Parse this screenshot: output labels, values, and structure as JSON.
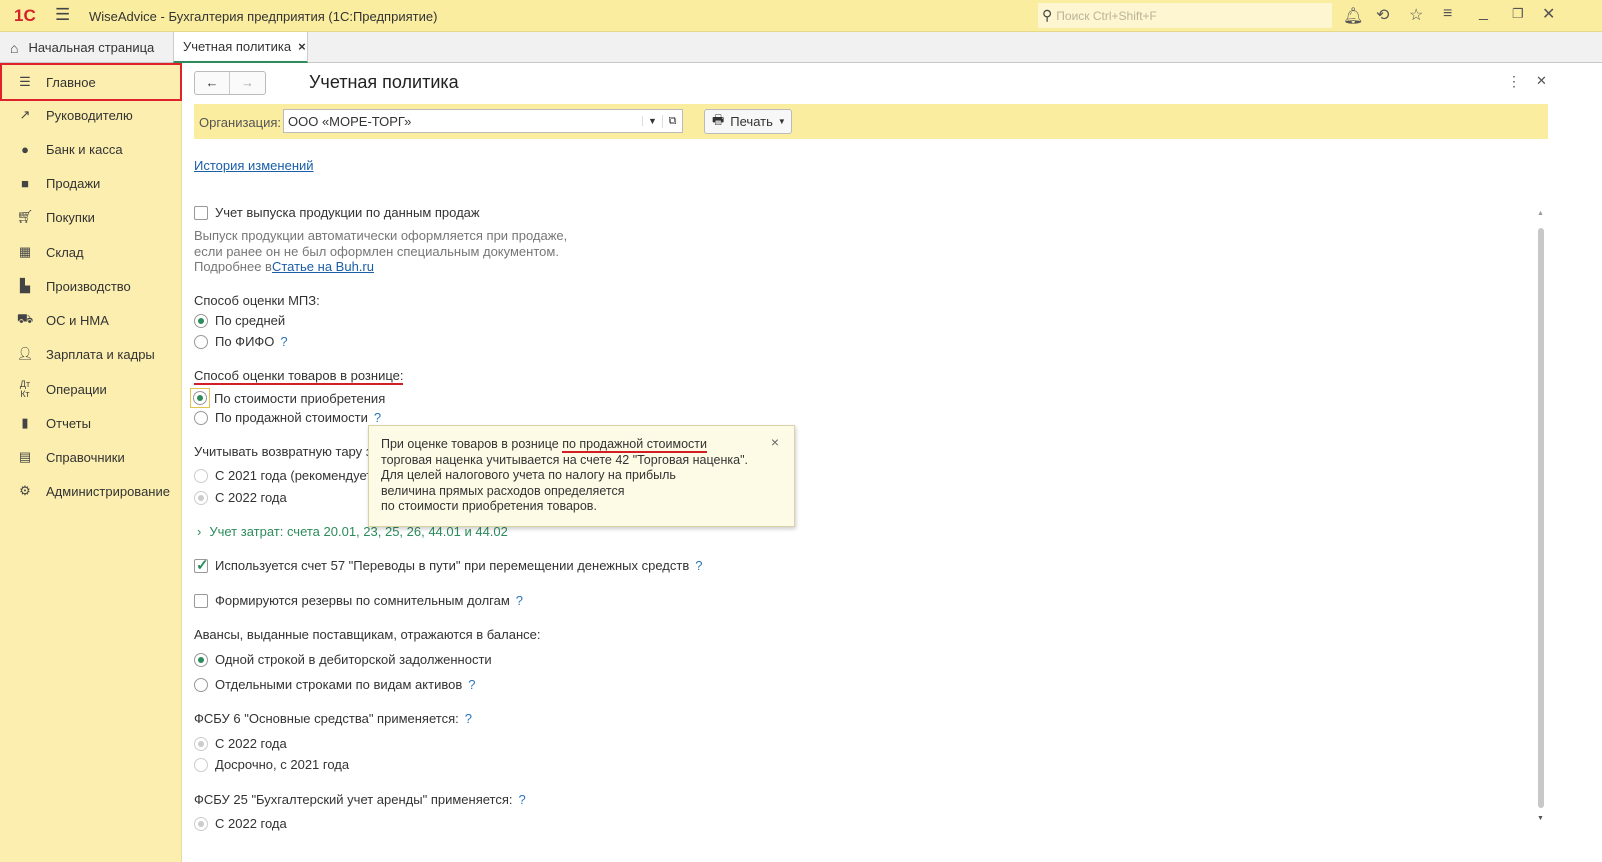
{
  "window": {
    "title": "WiseAdvice - Бухгалтерия предприятия  (1С:Предприятие)",
    "logo": "1С",
    "search_placeholder": "Поиск Ctrl+Shift+F"
  },
  "tabs": [
    {
      "label": "Начальная страница"
    },
    {
      "label": "Учетная политика",
      "close": "×"
    }
  ],
  "sidebar": {
    "items": [
      {
        "label": "Главное",
        "icon": "menu-icon"
      },
      {
        "label": "Руководителю",
        "icon": "trend-icon"
      },
      {
        "label": "Банк и касса",
        "icon": "coin-icon"
      },
      {
        "label": "Продажи",
        "icon": "bag-icon"
      },
      {
        "label": "Покупки",
        "icon": "cart-icon"
      },
      {
        "label": "Склад",
        "icon": "grid-icon"
      },
      {
        "label": "Производство",
        "icon": "factory-icon"
      },
      {
        "label": "ОС и НМА",
        "icon": "truck-icon"
      },
      {
        "label": "Зарплата и кадры",
        "icon": "person-icon"
      },
      {
        "label": "Операции",
        "icon": "operations-icon"
      },
      {
        "label": "Отчеты",
        "icon": "chart-icon"
      },
      {
        "label": "Справочники",
        "icon": "book-icon"
      },
      {
        "label": "Администрирование",
        "icon": "gear-icon"
      }
    ]
  },
  "form": {
    "title": "Учетная политика",
    "org_label": "Организация:",
    "org_value": "ООО «МОРЕ-ТОРГ»",
    "print_label": "Печать",
    "history_link": "История изменений",
    "release_cb": "Учет выпуска продукции по данным продаж",
    "release_hint1": "Выпуск продукции автоматически оформляется при продаже,",
    "release_hint2": "если ранее он не был оформлен специальным документом.",
    "release_hint3": "Подробнее в ",
    "release_link": "Статье на Buh.ru",
    "mpz_label": "Способ оценки МПЗ:",
    "mpz_opt1": "По средней",
    "mpz_opt2": "По ФИФО",
    "retail_label": "Способ оценки товаров в рознице:",
    "retail_opt1": "По стоимости приобретения",
    "retail_opt2": "По продажной стоимости",
    "tara_label": "Учитывать возвратную тару за",
    "tara_opt1": "С 2021 года (рекомендует",
    "tara_opt2": "С 2022 года",
    "costs_link": "Учет затрат: счета 20.01, 23, 25, 26, 44.01 и 44.02",
    "acc57_cb": "Используется счет 57 \"Переводы в пути\" при перемещении денежных средств",
    "reserve_cb": "Формируются резервы по сомнительным долгам",
    "adv_label": "Авансы, выданные поставщикам, отражаются в балансе:",
    "adv_opt1": "Одной строкой в дебиторской задолженности",
    "adv_opt2": "Отдельными строками по видам активов",
    "fsbu6_label": "ФСБУ 6 \"Основные средства\" применяется:",
    "fsbu6_opt1": "С 2022 года",
    "fsbu6_opt2": "Досрочно, с 2021 года",
    "fsbu25_label": "ФСБУ 25 \"Бухгалтерский учет аренды\" применяется:",
    "fsbu25_opt1": "С 2022 года",
    "help": "?"
  },
  "tooltip": {
    "line1a": "При оценке товаров в рознице ",
    "line1b": "по продажной стоимости",
    "line2": "торговая наценка учитывается на счете 42 \"Торговая наценка\".",
    "line3": "Для целей налогового учета по налогу на прибыль",
    "line4": "величина прямых расходов определяется",
    "line5": "по стоимости приобретения товаров.",
    "close": "×"
  },
  "colors": {
    "accent": "#2c8c5b",
    "highlight": "#e0232a",
    "titlebar": "#fbeda0",
    "sidebar": "#fbeeae"
  }
}
